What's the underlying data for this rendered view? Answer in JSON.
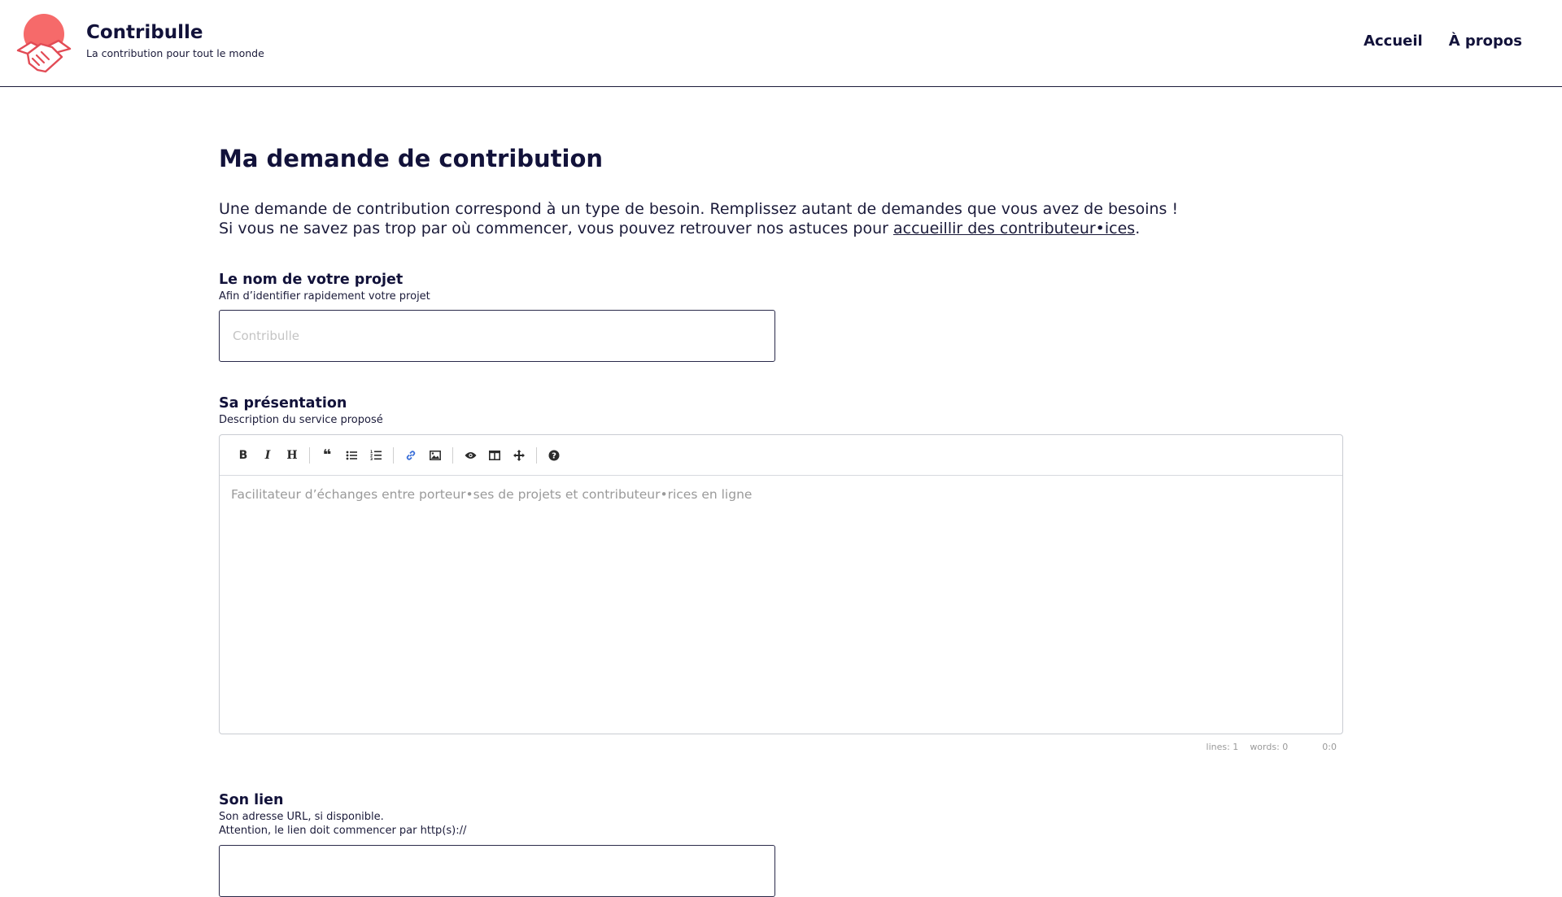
{
  "header": {
    "brand_title": "Contribulle",
    "brand_subtitle": "La contribution pour tout le monde",
    "logo_icon": "handshake-sun-icon",
    "accent_color": "#f66a6a",
    "nav": [
      {
        "label": "Accueil"
      },
      {
        "label": "À propos"
      }
    ]
  },
  "main": {
    "title": "Ma demande de contribution",
    "intro_line1": "Une demande de contribution correspond à un type de besoin. Remplissez autant de demandes que vous avez de besoins !",
    "intro_line2_before": "Si vous ne savez pas trop par où commencer, vous pouvez retrouver nos astuces pour ",
    "intro_link": "accueillir des contributeur•ices",
    "intro_line2_after": ".",
    "project_name": {
      "label": "Le nom de votre projet",
      "help": "Afin d’identifier rapidement votre projet",
      "placeholder": "Contribulle",
      "value": ""
    },
    "presentation": {
      "label": "Sa présentation",
      "help": "Description du service proposé",
      "placeholder": "Facilitateur d’échanges entre porteur•ses de projets et contributeur•rices en ligne",
      "toolbar": [
        "bold-icon",
        "italic-icon",
        "heading-icon",
        "quote-icon",
        "unordered-list-icon",
        "ordered-list-icon",
        "link-icon",
        "image-icon",
        "preview-icon",
        "side-by-side-icon",
        "fullscreen-icon",
        "help-icon"
      ],
      "status_lines": "lines: 1",
      "status_words": "words: 0",
      "status_cursor": "0:0"
    },
    "link": {
      "label": "Son lien",
      "help_line1": "Son adresse URL, si disponible.",
      "help_line2": "Attention, le lien doit commencer par http(s)://"
    }
  }
}
